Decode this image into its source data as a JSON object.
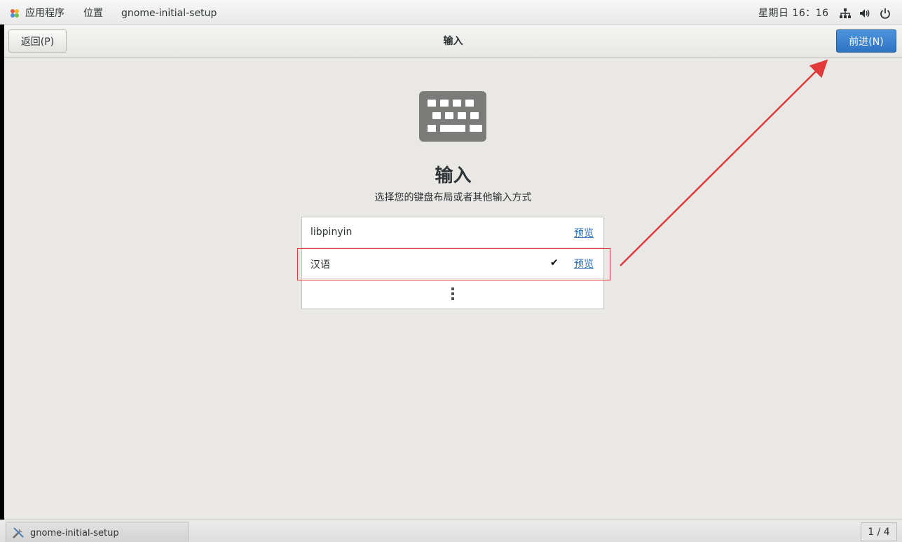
{
  "top_panel": {
    "applications_label": "应用程序",
    "places_label": "位置",
    "app_name": "gnome-initial-setup",
    "clock": "星期日 16：16",
    "icons": [
      "network-icon",
      "volume-icon",
      "power-icon"
    ]
  },
  "header": {
    "back_label": "返回(P)",
    "title": "输入",
    "next_label": "前进(N)"
  },
  "main": {
    "heading": "输入",
    "subtitle": "选择您的键盘布局或者其他输入方式",
    "input_sources": [
      {
        "label": "libpinyin",
        "selected": false,
        "preview_label": "预览"
      },
      {
        "label": "汉语",
        "selected": true,
        "preview_label": "预览"
      }
    ],
    "check_mark": "✔"
  },
  "taskbar": {
    "window_label": "gnome-initial-setup",
    "workspace": "1 / 4"
  },
  "colors": {
    "accent": "#3584e4",
    "annotation": "#e03a3a",
    "link": "#2a6eb8",
    "background": "#e9e8e5"
  }
}
